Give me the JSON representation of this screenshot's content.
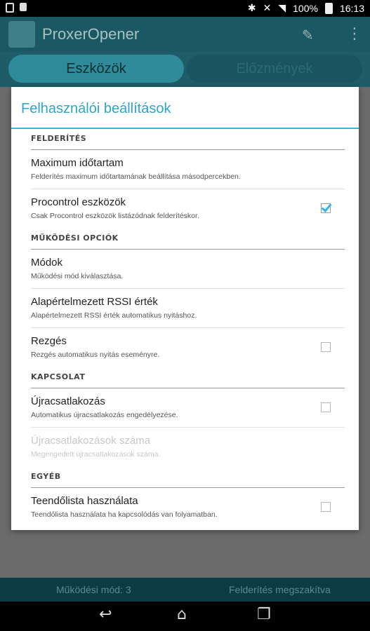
{
  "status_bar": {
    "battery": "100%",
    "time": "16:13"
  },
  "app": {
    "title": "ProxerOpener"
  },
  "tabs": [
    {
      "label": "Eszközök",
      "active": true
    },
    {
      "label": "Előzmények",
      "active": false
    }
  ],
  "bottom_info": {
    "mode": "Működési mód: 3",
    "status": "Felderítés megszakítva"
  },
  "dialog": {
    "title": "Felhasználói beállítások",
    "sections": [
      {
        "header": "FELDERÍTÉS",
        "prefs": [
          {
            "title": "Maximum időtartam",
            "summary": "Felderítés maximum időtartamának beállítása másodpercekben.",
            "checkbox": null
          },
          {
            "title": "Procontrol eszközök",
            "summary": "Csak Procontrol eszközök listázódnak felderítéskor.",
            "checkbox": true
          }
        ]
      },
      {
        "header": "MŰKÖDÉSI OPCIÓK",
        "prefs": [
          {
            "title": "Módok",
            "summary": "Működési mód kiválasztása.",
            "checkbox": null
          },
          {
            "title": "Alapértelmezett RSSI érték",
            "summary": "Alapértelmezett RSSI érték automatikus nyitáshoz.",
            "checkbox": null
          },
          {
            "title": "Rezgés",
            "summary": "Rezgés automatikus nyitás eseményre.",
            "checkbox": false
          }
        ]
      },
      {
        "header": "KAPCSOLAT",
        "prefs": [
          {
            "title": "Újracsatlakozás",
            "summary": "Automatikus újracsatlakozás engedélyezése.",
            "checkbox": false
          },
          {
            "title": "Újracsatlakozások száma",
            "summary": "Megengedett újracsatlakozások száma.",
            "checkbox": null,
            "disabled": true
          }
        ]
      },
      {
        "header": "EGYÉB",
        "prefs": [
          {
            "title": "Teendőlista használata",
            "summary": "Teendőlista használata ha kapcsolódás van folyamatban.",
            "checkbox": false
          }
        ]
      }
    ]
  },
  "colors": {
    "accent": "#33b5e5",
    "title": "#2aa6cf"
  },
  "icons": {
    "wrench": "wrench-icon",
    "overflow": "overflow-menu-icon",
    "back": "back-icon",
    "home": "home-icon",
    "recents": "recents-icon"
  }
}
